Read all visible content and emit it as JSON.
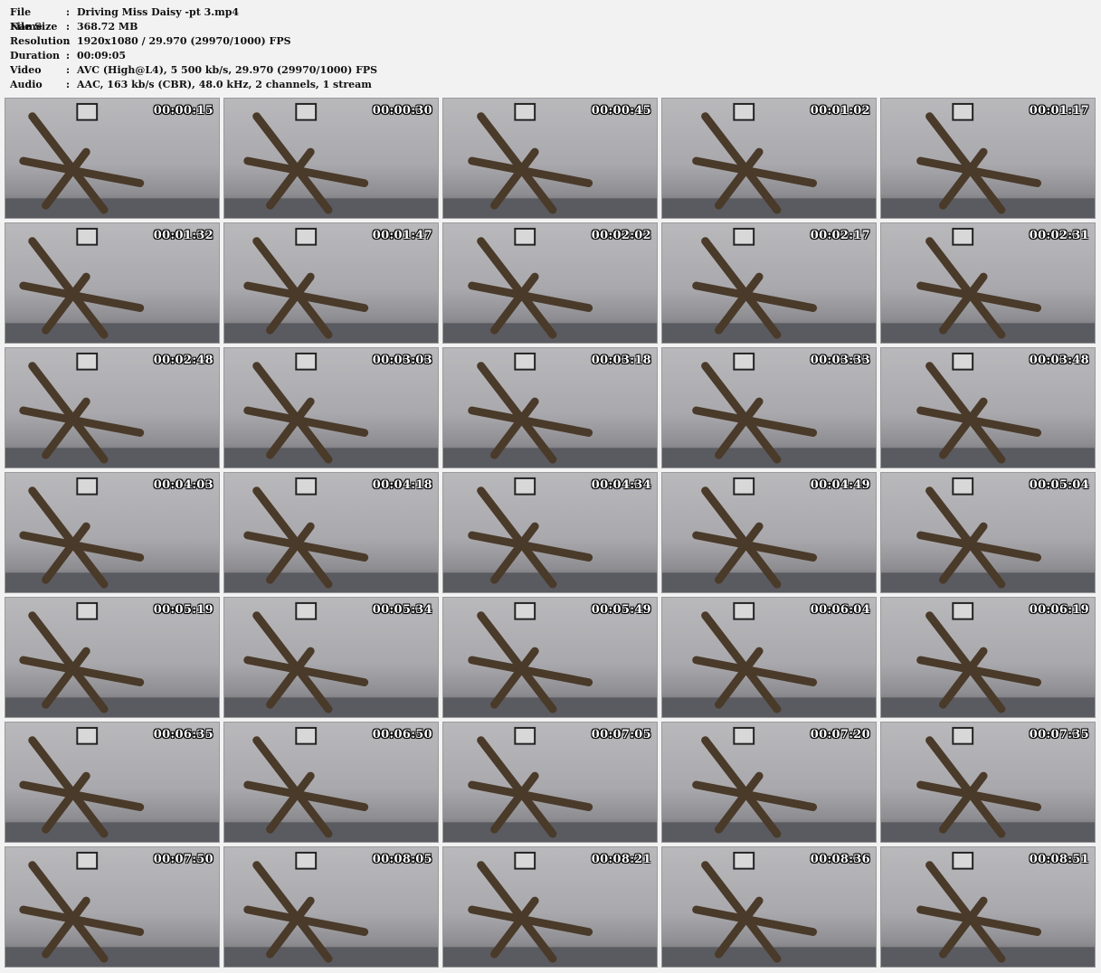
{
  "info": {
    "file_name_label": "File Name",
    "file_name": "Driving Miss Daisy -pt 3.mp4",
    "file_size_label": "File Size",
    "file_size": "368.72 MB",
    "resolution_label": "Resolution",
    "resolution": "1920x1080 / 29.970 (29970/1000) FPS",
    "duration_label": "Duration",
    "duration": "00:09:05",
    "video_label": "Video",
    "video": "AVC (High@L4), 5 500 kb/s, 29.970 (29970/1000) FPS",
    "audio_label": "Audio",
    "audio": "AAC, 163 kb/s (CBR), 48.0 kHz, 2 channels, 1 stream",
    "separator": ":"
  },
  "thumbnails": [
    "00:00:15",
    "00:00:30",
    "00:00:45",
    "00:01:02",
    "00:01:17",
    "00:01:32",
    "00:01:47",
    "00:02:02",
    "00:02:17",
    "00:02:31",
    "00:02:48",
    "00:03:03",
    "00:03:18",
    "00:03:33",
    "00:03:48",
    "00:04:03",
    "00:04:18",
    "00:04:34",
    "00:04:49",
    "00:05:04",
    "00:05:19",
    "00:05:34",
    "00:05:49",
    "00:06:04",
    "00:06:19",
    "00:06:35",
    "00:06:50",
    "00:07:05",
    "00:07:20",
    "00:07:35",
    "00:07:50",
    "00:08:05",
    "00:08:21",
    "00:08:36",
    "00:08:51"
  ]
}
